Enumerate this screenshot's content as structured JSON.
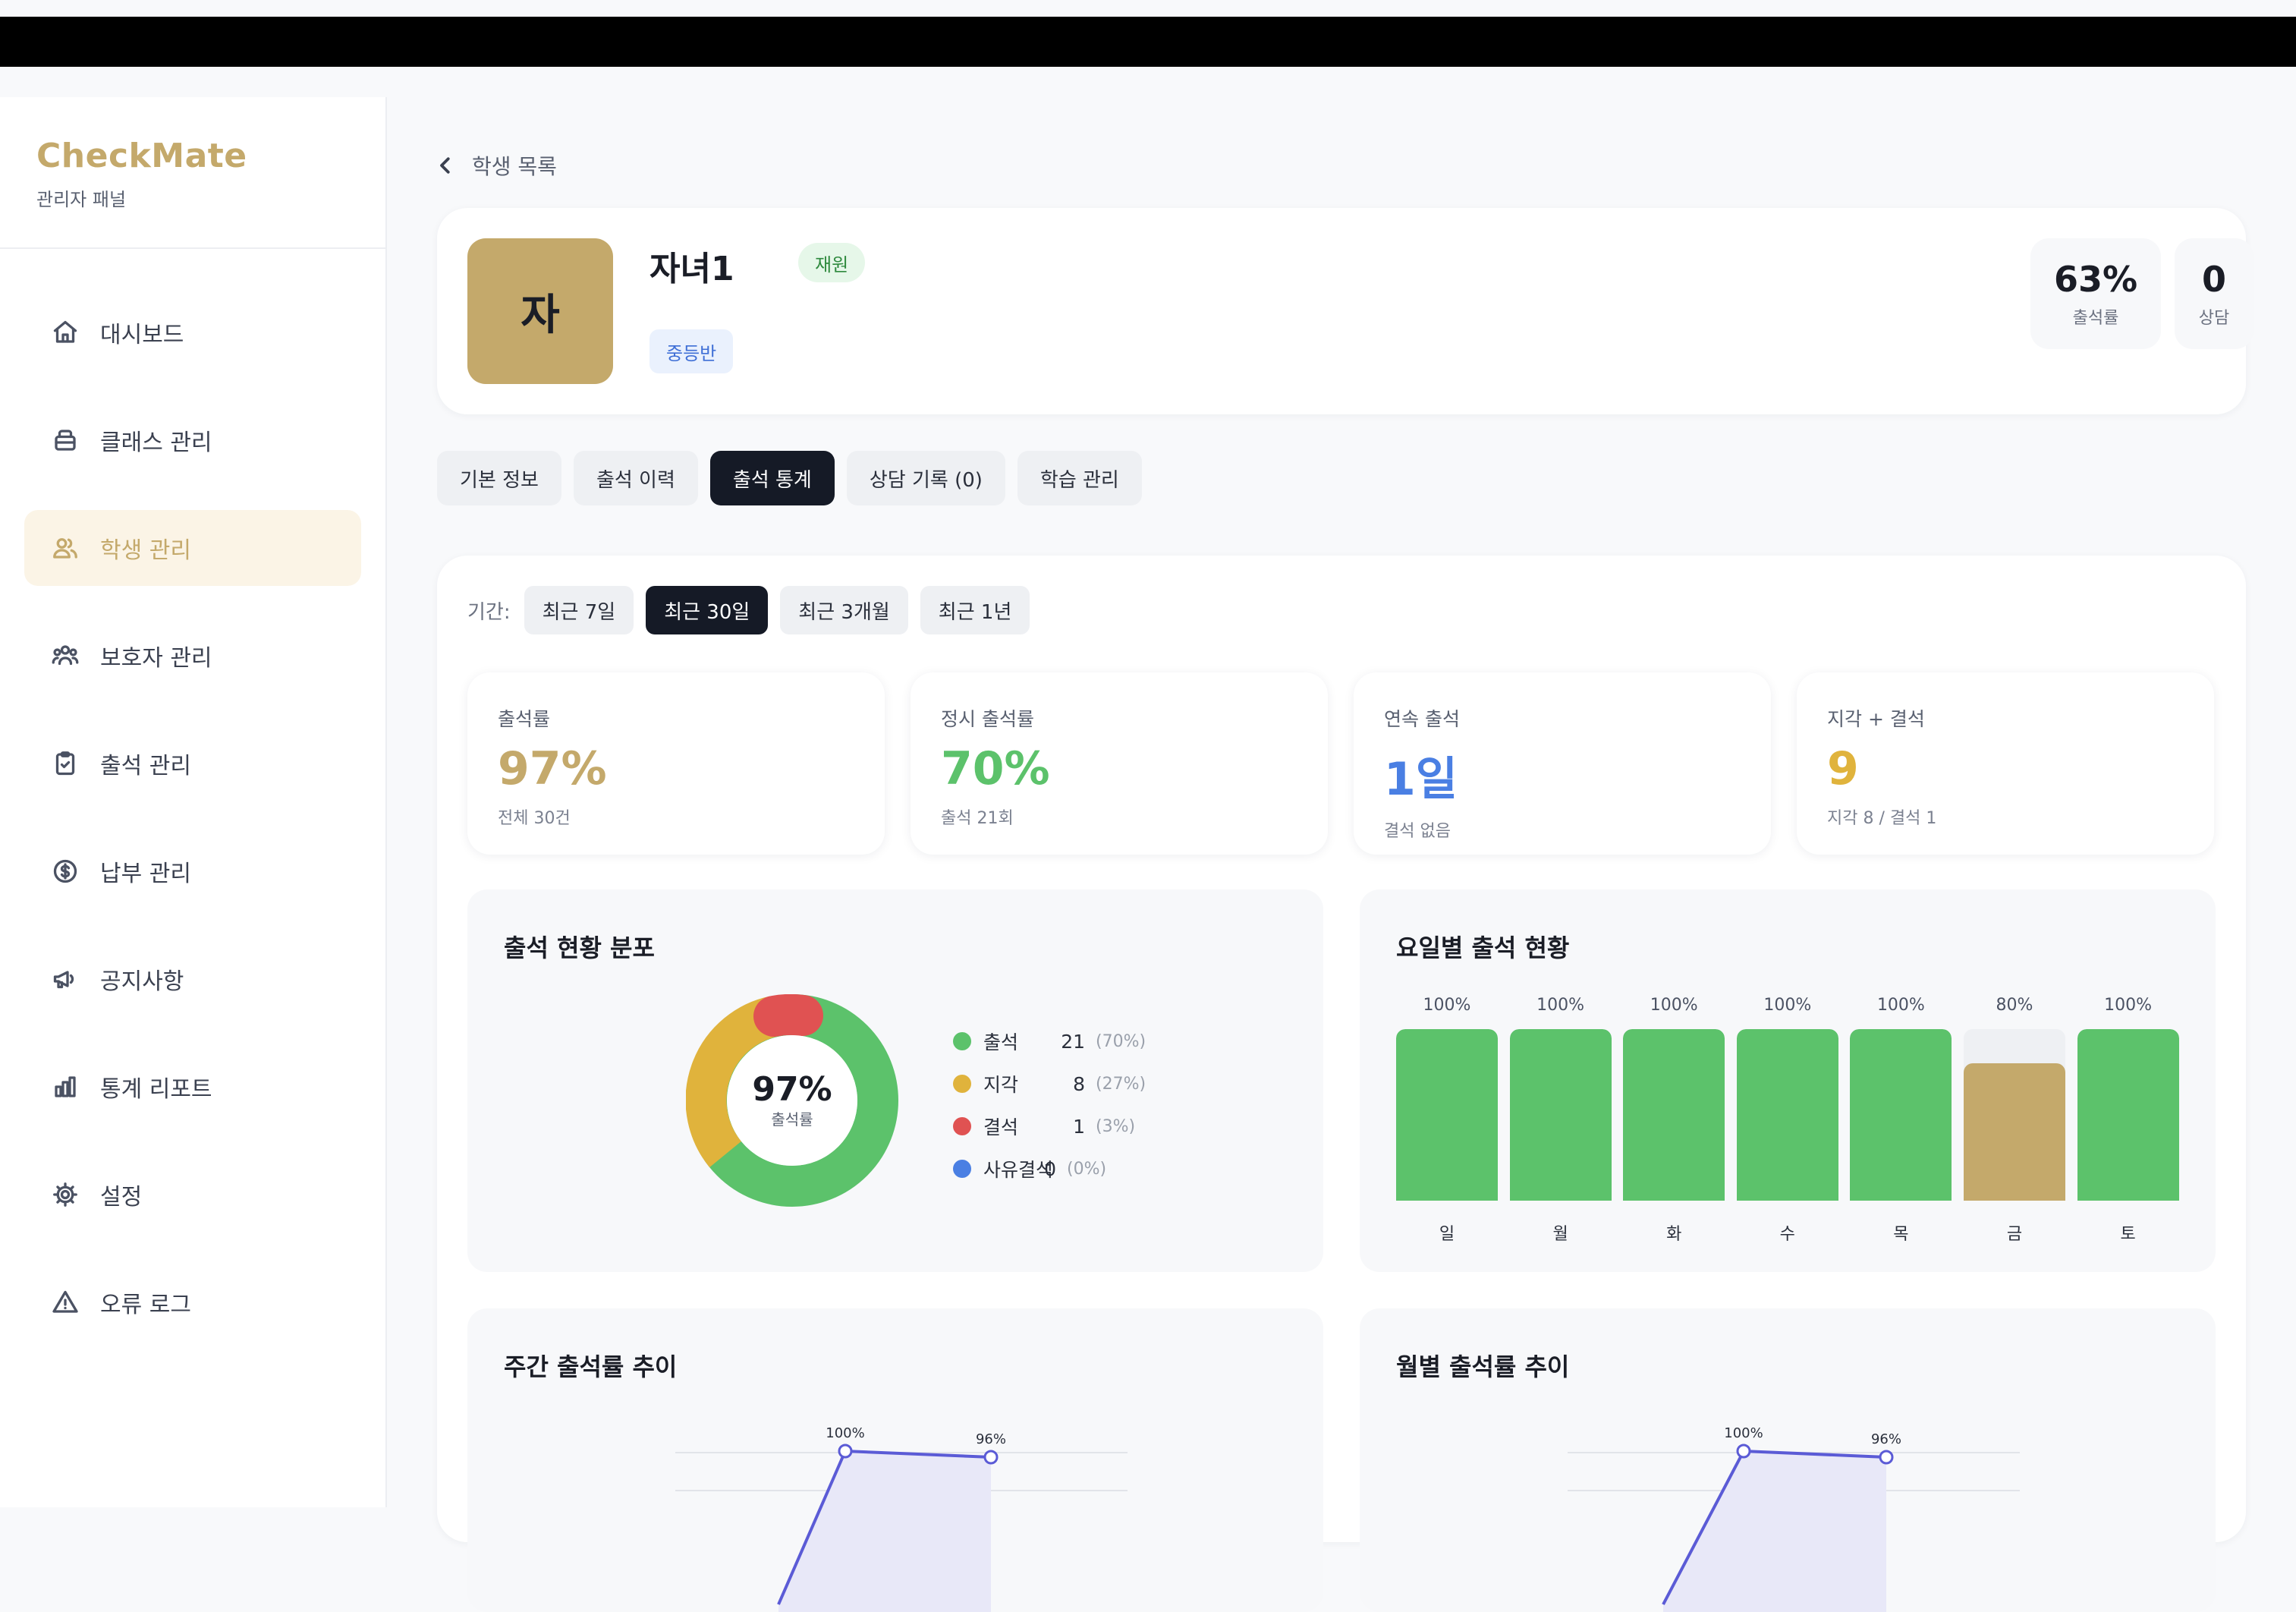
{
  "sidebar": {
    "brand": "CheckMate",
    "subtitle": "관리자 패널",
    "items": [
      {
        "label": "대시보드",
        "icon": "home-icon"
      },
      {
        "label": "클래스 관리",
        "icon": "class-icon"
      },
      {
        "label": "학생 관리",
        "icon": "students-icon",
        "active": true
      },
      {
        "label": "보호자 관리",
        "icon": "guardians-icon"
      },
      {
        "label": "출석 관리",
        "icon": "clipboard-check-icon"
      },
      {
        "label": "납부 관리",
        "icon": "dollar-circle-icon"
      },
      {
        "label": "공지사항",
        "icon": "megaphone-icon"
      },
      {
        "label": "통계 리포트",
        "icon": "bar-chart-icon"
      },
      {
        "label": "설정",
        "icon": "gear-icon"
      },
      {
        "label": "오류 로그",
        "icon": "warning-icon"
      }
    ]
  },
  "back_label": "학생 목록",
  "profile": {
    "avatar_initial": "자",
    "name": "자녀1",
    "status": "재원",
    "class_name": "중등반",
    "stats": [
      {
        "value": "63%",
        "label": "출석률"
      },
      {
        "value": "0",
        "label": "상담"
      }
    ]
  },
  "tabs": [
    "기본 정보",
    "출석 이력",
    "출석 통계",
    "상담 기록 (0)",
    "학습 관리"
  ],
  "active_tab": "출석 통계",
  "period": {
    "label": "기간:",
    "options": [
      "최근 7일",
      "최근 30일",
      "최근 3개월",
      "최근 1년"
    ],
    "selected": "최근 30일"
  },
  "kpis": [
    {
      "label": "출석률",
      "value": "97%",
      "sub": "전체 30건",
      "color": "#c4a96b"
    },
    {
      "label": "정시 출석률",
      "value": "70%",
      "sub": "출석 21회",
      "color": "#5cc26b"
    },
    {
      "label": "연속 출석",
      "value": "1일",
      "sub": "결석 없음",
      "color": "#4a7fe3"
    },
    {
      "label": "지각 + 결석",
      "value": "9",
      "sub": "지각 8 / 결석 1",
      "color": "#e0b33c"
    }
  ],
  "distribution": {
    "title": "출석 현황 분포",
    "center_value": "97%",
    "center_label": "출석률",
    "items": [
      {
        "name": "출석",
        "count": "21",
        "pct": "(70%)",
        "color": "#5cc26b"
      },
      {
        "name": "지각",
        "count": "8",
        "pct": "(27%)",
        "color": "#e0b33c"
      },
      {
        "name": "결석",
        "count": "1",
        "pct": "(3%)",
        "color": "#e05252"
      },
      {
        "name": "사유결석",
        "count": "0",
        "pct": "(0%)",
        "color": "#4a7fe3"
      }
    ]
  },
  "weekday": {
    "title": "요일별 출석 현황",
    "chart_data": {
      "type": "bar",
      "categories": [
        "일",
        "월",
        "화",
        "수",
        "목",
        "금",
        "토"
      ],
      "values": [
        100,
        100,
        100,
        100,
        100,
        80,
        100
      ],
      "labels": [
        "100%",
        "100%",
        "100%",
        "100%",
        "100%",
        "80%",
        "100%"
      ],
      "ylim": [
        0,
        100
      ],
      "colors": {
        "full": "#5cc26b",
        "partial": "#c4a96b",
        "track": "#eef0f3"
      }
    }
  },
  "weekly_trend": {
    "title": "주간 출석률 추이",
    "point_labels": [
      "100%",
      "96%"
    ]
  },
  "monthly_trend": {
    "title": "월별 출석률 추이",
    "point_labels": [
      "100%",
      "96%"
    ]
  },
  "colors": {
    "accent": "#c4a96b",
    "dark": "#151a26",
    "line": "#5b5bd6"
  }
}
